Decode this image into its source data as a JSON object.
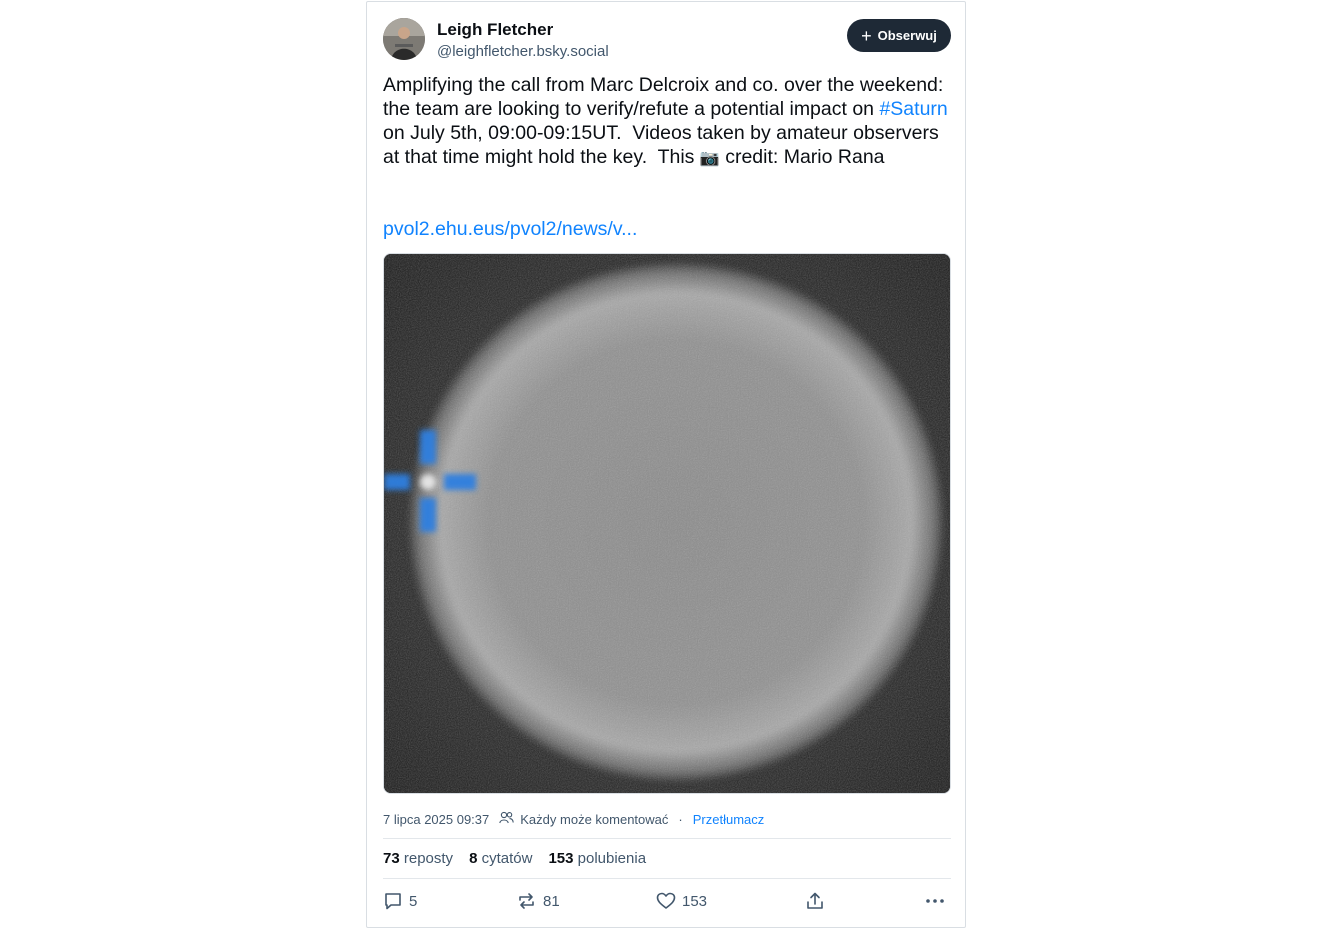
{
  "author": {
    "name": "Leigh Fletcher",
    "handle": "@leighfletcher.bsky.social"
  },
  "follow_label": "Obserwuj",
  "post": {
    "text_before_tag": "Amplifying the call from Marc Delcroix and co. over the weekend: the team are looking to verify/refute a potential impact on ",
    "hashtag": "#Saturn",
    "text_after_tag": " on July 5th, 09:00-09:15UT.  Videos taken by amateur observers at that time might hold the key.  This ",
    "camera_emoji": "📷",
    "text_end": " credit: Mario Rana",
    "link": "pvol2.ehu.eus/pvol2/news/v..."
  },
  "meta": {
    "timestamp": "7 lipca 2025 09:37",
    "reply_setting": "Każdy może komentować",
    "separator": "·",
    "translate": "Przetłumacz"
  },
  "stats": {
    "reposts_count": "73",
    "reposts_label": "reposty",
    "quotes_count": "8",
    "quotes_label": "cytatów",
    "likes_count": "153",
    "likes_label": "polubienia"
  },
  "actions": {
    "replies": "5",
    "reposts": "81",
    "likes": "153"
  },
  "colors": {
    "link": "#1083fe",
    "follow_button": "#1e2936",
    "secondary_text": "#42576c"
  }
}
